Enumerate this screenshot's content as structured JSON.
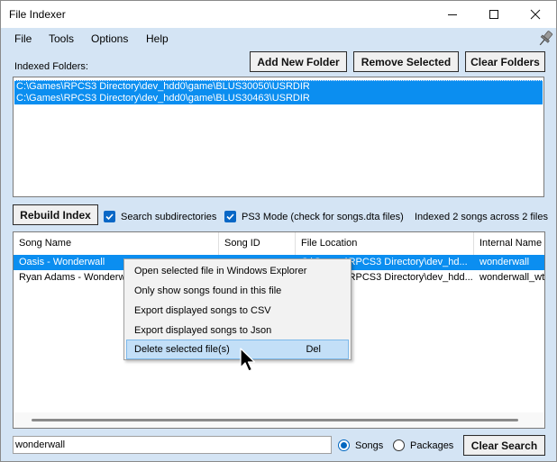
{
  "window": {
    "title": "File Indexer"
  },
  "menu": {
    "items": [
      "File",
      "Tools",
      "Options",
      "Help"
    ]
  },
  "folders": {
    "label": "Indexed Folders:",
    "add_label": "Add New Folder",
    "remove_label": "Remove Selected",
    "clear_label": "Clear Folders",
    "items": [
      "C:\\Games\\RPCS3 Directory\\dev_hdd0\\game\\BLUS30050\\USRDIR",
      "C:\\Games\\RPCS3 Directory\\dev_hdd0\\game\\BLUS30463\\USRDIR"
    ]
  },
  "options": {
    "rebuild_label": "Rebuild Index",
    "search_subdirs_label": "Search subdirectories",
    "search_subdirs_checked": true,
    "ps3_mode_label": "PS3 Mode (check for songs.dta files)",
    "ps3_mode_checked": true,
    "status": "Indexed 2 songs across 2 files"
  },
  "grid": {
    "columns": [
      "Song Name",
      "Song ID",
      "File Location",
      "Internal Name"
    ],
    "rows": [
      {
        "song_name": "Oasis - Wonderwall",
        "song_id": "",
        "file_location": "C:\\Games\\RPCS3 Directory\\dev_hd...",
        "internal_name": "wonderwall",
        "selected": true
      },
      {
        "song_name": "Ryan Adams - Wonderwall",
        "song_id": "",
        "file_location": "C:\\Games\\RPCS3 Directory\\dev_hdd...",
        "internal_name": "wonderwall_wtc",
        "selected": false
      }
    ]
  },
  "context_menu": {
    "items": [
      {
        "label": "Open selected file in Windows Explorer",
        "shortcut": ""
      },
      {
        "label": "Only show songs found in this file",
        "shortcut": ""
      },
      {
        "label": "Export displayed songs to CSV",
        "shortcut": ""
      },
      {
        "label": "Export displayed songs to Json",
        "shortcut": ""
      },
      {
        "label": "Delete selected file(s)",
        "shortcut": "Del"
      }
    ],
    "hovered_index": 4
  },
  "search": {
    "value": "wonderwall",
    "mode_songs_label": "Songs",
    "mode_packages_label": "Packages",
    "selected_mode": "Songs",
    "clear_label": "Clear Search"
  },
  "colors": {
    "window_bg": "#d4e4f4",
    "selection": "#0b8ef0",
    "accent": "#0867c6",
    "menu_hover": "#c3dff7"
  },
  "icons": [
    "minimize-icon",
    "maximize-icon",
    "close-icon",
    "pin-icon",
    "checkmark-icon",
    "mouse-cursor-icon"
  ]
}
